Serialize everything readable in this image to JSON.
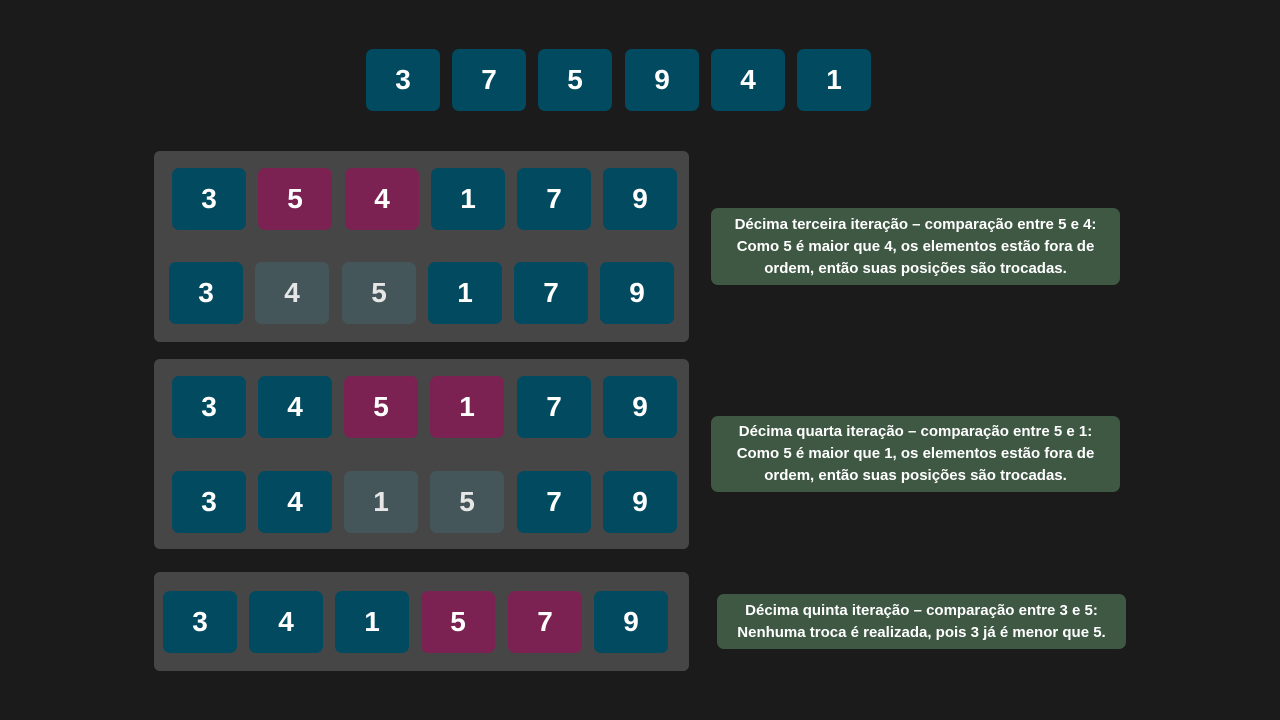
{
  "initial_array": [
    "3",
    "7",
    "5",
    "9",
    "4",
    "1"
  ],
  "steps": [
    {
      "before": [
        "3",
        "5",
        "4",
        "1",
        "7",
        "9"
      ],
      "after": [
        "3",
        "4",
        "5",
        "1",
        "7",
        "9"
      ],
      "note": [
        "Décima terceira iteração – comparação entre 5 e 4:",
        "Como 5 é maior que 4, os elementos estão fora de",
        "ordem, então suas posições são trocadas."
      ]
    },
    {
      "before": [
        "3",
        "4",
        "5",
        "1",
        "7",
        "9"
      ],
      "after": [
        "3",
        "4",
        "1",
        "5",
        "7",
        "9"
      ],
      "note": [
        "Décima quarta iteração – comparação entre 5 e 1:",
        "Como 5 é maior que 1, os elementos estão fora de",
        "ordem, então suas posições são trocadas."
      ]
    },
    {
      "before": [
        "3",
        "4",
        "1",
        "5",
        "7",
        "9"
      ],
      "note": [
        "Décima quinta iteração – comparação entre 3 e 5:",
        "Nenhuma troca é realizada, pois 3 já é menor que 5."
      ]
    }
  ],
  "colors": {
    "default_cell": "#014a5f",
    "compared_cell": "#7b2252",
    "swapped_cell": "#45565a",
    "panel": "#464646",
    "note": "#3e5843",
    "background": "#1b1b1b"
  }
}
